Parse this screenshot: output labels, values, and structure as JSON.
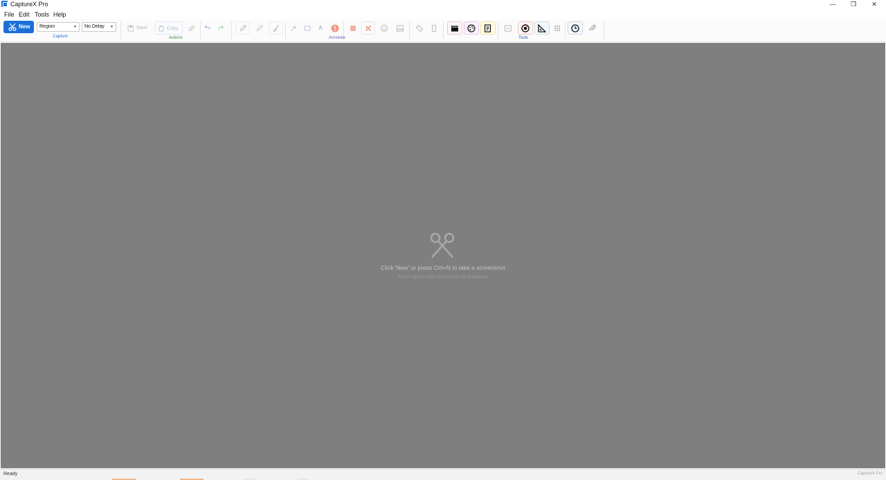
{
  "window": {
    "title": "CaptureX Pro",
    "controls": [
      "minimize",
      "restore",
      "close"
    ]
  },
  "menu": [
    "File",
    "Edit",
    "Tools",
    "Help"
  ],
  "ribbon": {
    "capture": {
      "label": "Capture",
      "new_label": "New",
      "mode": "Region",
      "delay": "No Delay"
    },
    "actions": {
      "label": "Actions",
      "save_label": "Save",
      "copy_label": "Copy"
    },
    "annotate": {
      "label": "Annotate"
    },
    "tools": {
      "label": "Tools"
    }
  },
  "canvas": {
    "message": "Click 'New' or press Ctrl+N to take a screenshot",
    "hint": "Select capture mode from the top two dropdowns"
  },
  "status": {
    "text": "Ready",
    "brand": "CaptureX Pro"
  },
  "colors": {
    "accent": "#1c6fd8",
    "capture_label": "#1c6fd8",
    "actions_label": "#2e8b3a",
    "annotate_label": "#7b5fc0",
    "tools_label": "#1e5fb0",
    "canvas_bg": "#7f7f7f"
  }
}
